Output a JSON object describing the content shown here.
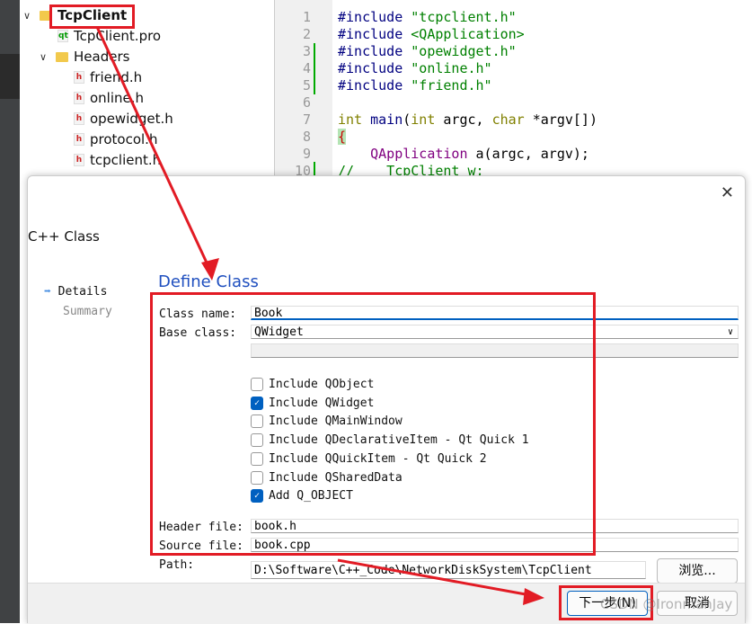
{
  "tree": {
    "project": "TcpClient",
    "pro_file": "TcpClient.pro",
    "headers_folder": "Headers",
    "headers": [
      "friend.h",
      "online.h",
      "opewidget.h",
      "protocol.h",
      "tcpclient.h"
    ]
  },
  "editor": {
    "line_numbers": [
      "1",
      "2",
      "3",
      "4",
      "5",
      "6",
      "7",
      "8",
      "9",
      "10"
    ],
    "lines": [
      "#include \"tcpclient.h\"",
      "#include <QApplication>",
      "#include \"opewidget.h\"",
      "#include \"online.h\"",
      "#include \"friend.h\"",
      "",
      "int main(int argc, char *argv[])",
      "{",
      "    QApplication a(argc, argv);",
      "//    TcpClient w;"
    ]
  },
  "dialog": {
    "window_title": "C++ Class",
    "close_icon": "close-icon",
    "nav": [
      {
        "label": "Details",
        "active": true
      },
      {
        "label": "Summary",
        "active": false
      }
    ],
    "section_title": "Define Class",
    "class_name_label": "Class name:",
    "class_name": "Book",
    "base_class_label": "Base class:",
    "base_class": "QWidget",
    "options": [
      {
        "label": "Include QObject",
        "checked": false
      },
      {
        "label": "Include QWidget",
        "checked": true
      },
      {
        "label": "Include QMainWindow",
        "checked": false
      },
      {
        "label": "Include QDeclarativeItem - Qt Quick 1",
        "checked": false
      },
      {
        "label": "Include QQuickItem - Qt Quick 2",
        "checked": false
      },
      {
        "label": "Include QSharedData",
        "checked": false
      },
      {
        "label": "Add Q_OBJECT",
        "checked": true
      }
    ],
    "header_label": "Header file:",
    "header_file": "book.h",
    "source_label": "Source file:",
    "source_file": "book.cpp",
    "path_label": "Path:",
    "path": "D:\\Software\\C++_Code\\NetworkDiskSystem\\TcpClient",
    "browse": "浏览...",
    "next": "下一步(N)",
    "cancel": "取消"
  },
  "watermark": "CSDN @IronmanJay",
  "colors": {
    "annotation": "#e21b24",
    "accent": "#0060c0"
  }
}
